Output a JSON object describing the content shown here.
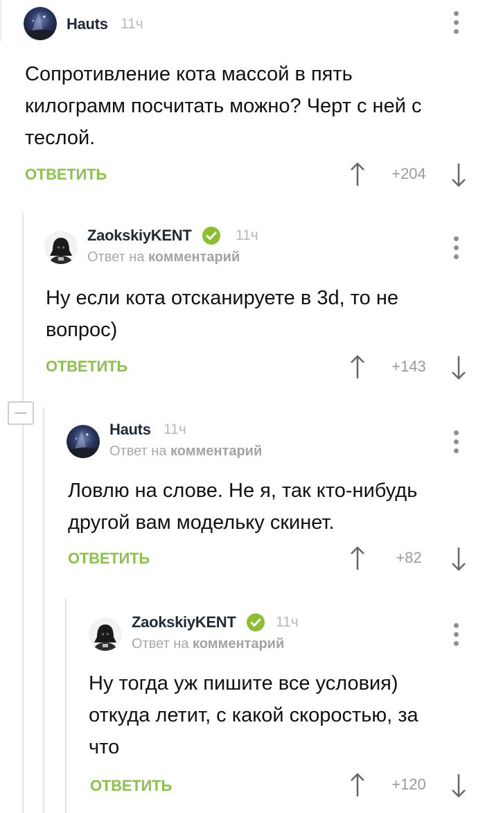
{
  "time_label": "11ч",
  "reply_label": "ОТВЕТИТЬ",
  "reply_to_prefix": "Ответ на",
  "reply_to_link": "комментарий",
  "comments": [
    {
      "author": "Hauts",
      "text_lines": [
        "Сопротивление кота массой в пять",
        "килограмм посчитать можно? Черт с ней с",
        "теслой."
      ],
      "score": "+204",
      "avatar": "galaxy-avatar"
    },
    {
      "author": "ZaokskiyKENT",
      "verified": true,
      "text_lines": [
        "Ну если кота отсканируете в 3d, то не",
        "вопрос)"
      ],
      "score": "+143",
      "avatar": "darth-vader-avatar"
    },
    {
      "author": "Hauts",
      "text_lines": [
        "Ловлю на слове. Не я, так кто-нибудь",
        "другой вам модельку скинет."
      ],
      "score": "+82",
      "avatar": "galaxy-avatar"
    },
    {
      "author": "ZaokskiyKENT",
      "verified": true,
      "text_lines": [
        "Ну тогда уж пишите все условия)",
        "откуда летит, с какой скоростью, за",
        "что"
      ],
      "score": "+120",
      "avatar": "darth-vader-avatar"
    }
  ],
  "colors": {
    "accent": "#8bc34a",
    "verified": "#8bbf2f",
    "muted": "#9a9a9a"
  }
}
